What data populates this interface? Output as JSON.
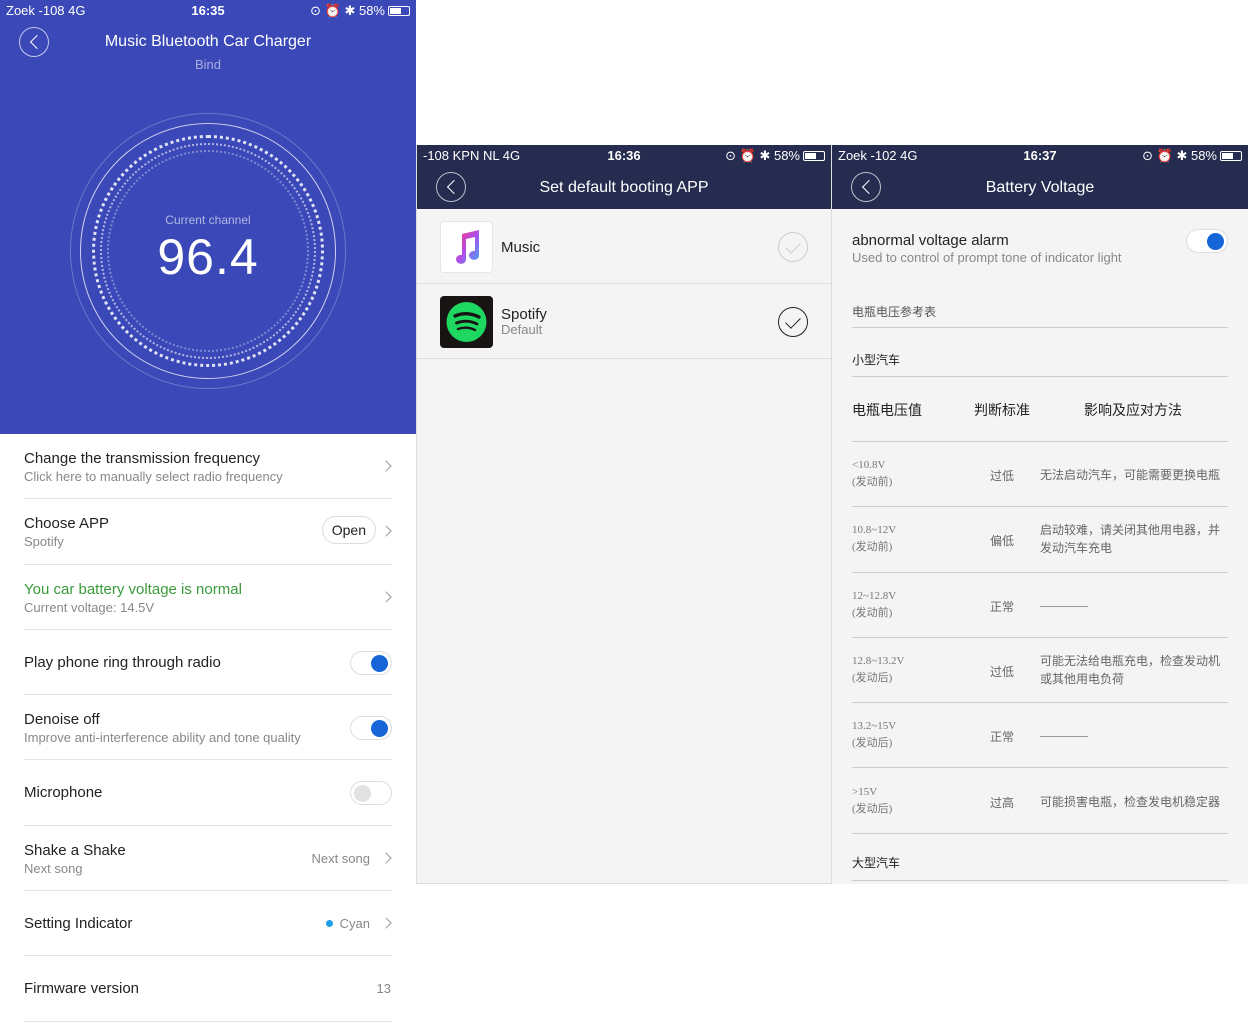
{
  "screen1": {
    "status": {
      "left": "Zoek  -108   4G",
      "time": "16:35",
      "battery": "58%"
    },
    "title": "Music Bluetooth Car Charger",
    "subtitle": "Bind",
    "channel_label": "Current channel",
    "channel_value": "96.4",
    "rows": {
      "frequency": {
        "title": "Change the transmission frequency",
        "sub": "Click here to manually select radio frequency"
      },
      "choose_app": {
        "title": "Choose APP",
        "sub": "Spotify",
        "button": "Open"
      },
      "battery": {
        "title": "You car battery voltage is normal",
        "sub": "Current voltage: 14.5V"
      },
      "ring": {
        "title": "Play phone ring through radio"
      },
      "denoise": {
        "title": "Denoise off",
        "sub": "Improve anti-interference ability and tone quality"
      },
      "microphone": {
        "title": "Microphone"
      },
      "shake": {
        "title": "Shake a Shake",
        "sub": "Next song",
        "value": "Next song"
      },
      "indicator": {
        "title": "Setting Indicator",
        "value": "Cyan"
      },
      "firmware": {
        "title": "Firmware version",
        "value": "13"
      }
    },
    "colors": {
      "hero": "#3a48b8",
      "normal": "#3a9a3a",
      "toggle_on": "#1565d8",
      "cyan_dot": "#1e9fe6"
    }
  },
  "screen2": {
    "status": {
      "left": "-108 KPN NL   4G",
      "time": "16:36",
      "battery": "58%"
    },
    "title": "Set default booting APP",
    "apps": [
      {
        "name": "Music",
        "sub": "",
        "icon": "apple-music-icon",
        "selected": false
      },
      {
        "name": "Spotify",
        "sub": "Default",
        "icon": "spotify-icon",
        "selected": true
      }
    ]
  },
  "screen3": {
    "status": {
      "left": "Zoek  -102   4G",
      "time": "16:37",
      "battery": "58%"
    },
    "title": "Battery Voltage",
    "alarm_title": "abnormal voltage alarm",
    "alarm_sub": "Used to control of prompt tone of  indicator light",
    "ref_title": "电瓶电压参考表",
    "small_car": "小型汽车",
    "large_car": "大型汽车",
    "headers": [
      "电瓶电压值",
      "判断标准",
      "影响及应对方法"
    ],
    "rows": [
      {
        "v1": "<10.8V",
        "v2": "(发动前)",
        "judge": "过低",
        "a1": "无法启动汽车，可能需要更换电瓶",
        "a2": ""
      },
      {
        "v1": "10.8~12V",
        "v2": "(发动前)",
        "judge": "偏低",
        "a1": "启动较难，请关闭其他用电器，并",
        "a2": "发动汽车充电"
      },
      {
        "v1": "12~12.8V",
        "v2": "(发动前)",
        "judge": "正常",
        "a1": "",
        "a2": ""
      },
      {
        "v1": "12.8~13.2V",
        "v2": "(发动后)",
        "judge": "过低",
        "a1": "可能无法给电瓶充电，检查发动机",
        "a2": "或其他用电负荷"
      },
      {
        "v1": "13.2~15V",
        "v2": "(发动后)",
        "judge": "正常",
        "a1": "",
        "a2": ""
      },
      {
        "v1": ">15V",
        "v2": "(发动后)",
        "judge": "过高",
        "a1": "可能损害电瓶，检查发电机稳定器",
        "a2": ""
      }
    ]
  }
}
